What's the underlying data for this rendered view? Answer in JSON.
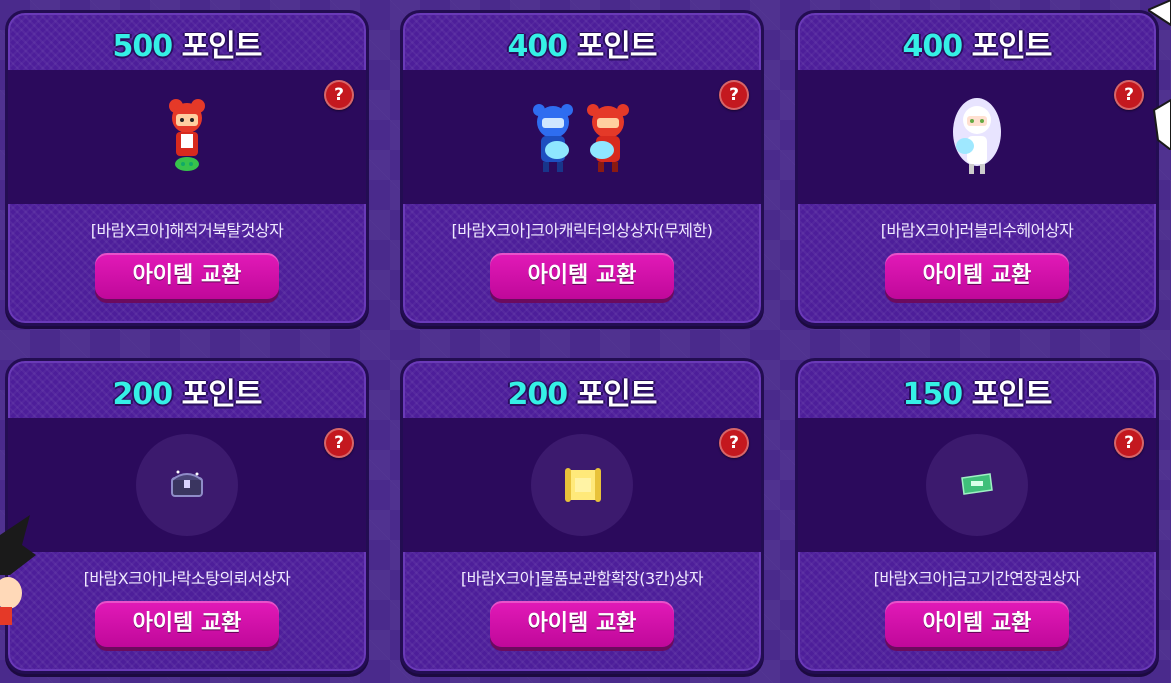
{
  "cards": [
    {
      "points": "500",
      "points_suffix": "포인트",
      "name": "[바람X크아]해적거북탈것상자",
      "button": "아이템 교환",
      "help": "?",
      "icon": "pirate-turtle-character-icon"
    },
    {
      "points": "400",
      "points_suffix": "포인트",
      "name": "[바람X크아]크아캐릭터의상상자(무제한)",
      "button": "아이템 교환",
      "help": "?",
      "icon": "kart-characters-icon"
    },
    {
      "points": "400",
      "points_suffix": "포인트",
      "name": "[바람X크아]러블리수헤어상자",
      "button": "아이템 교환",
      "help": "?",
      "icon": "lovely-hair-character-icon"
    },
    {
      "points": "200",
      "points_suffix": "포인트",
      "name": "[바람X크아]나락소탕의뢰서상자",
      "button": "아이템 교환",
      "help": "?",
      "icon": "treasure-chest-icon"
    },
    {
      "points": "200",
      "points_suffix": "포인트",
      "name": "[바람X크아]물품보관함확장(3칸)상자",
      "button": "아이템 교환",
      "help": "?",
      "icon": "scroll-icon"
    },
    {
      "points": "150",
      "points_suffix": "포인트",
      "name": "[바람X크아]금고기간연장권상자",
      "button": "아이템 교환",
      "help": "?",
      "icon": "ticket-icon"
    }
  ],
  "colors": {
    "points_number": "#35f0e6",
    "button": "#d412aa",
    "help": "#c4181f"
  }
}
